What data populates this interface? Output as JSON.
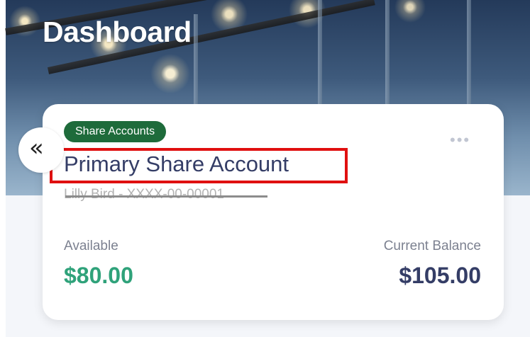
{
  "header": {
    "title": "Dashboard"
  },
  "account_card": {
    "type_badge": "Share Accounts",
    "name": "Primary Share Account",
    "number_masked": "Lilly Bird - XXXX-00-00001",
    "available_label": "Available",
    "available_value": "$80.00",
    "balance_label": "Current Balance",
    "balance_value": "$105.00",
    "more_icon": "more-horizontal-icon",
    "collapse_icon": "double-chevron-left-icon",
    "collapse_glyph": "«",
    "more_glyph": "•••"
  },
  "colors": {
    "badge_bg": "#1e6b3b",
    "available": "#2fa27a",
    "heading": "#343d66",
    "highlight": "#e01010"
  }
}
